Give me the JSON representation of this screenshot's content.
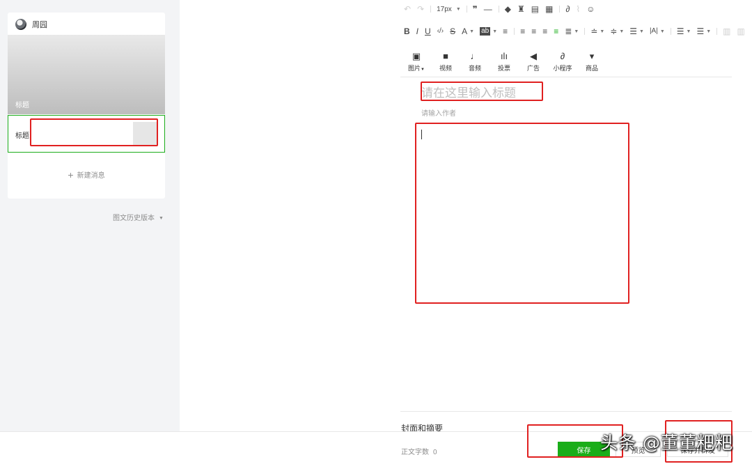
{
  "sidebar": {
    "account_name": "周园",
    "main_article_title": "标题",
    "sub_article_title": "标题",
    "new_message_label": "新建消息",
    "history_label": "图文历史版本"
  },
  "toolbar": {
    "font_size": "17px",
    "media": [
      {
        "label": "图片",
        "icon": "image-icon"
      },
      {
        "label": "视频",
        "icon": "video-icon"
      },
      {
        "label": "音频",
        "icon": "microphone-icon"
      },
      {
        "label": "投票",
        "icon": "poll-icon"
      },
      {
        "label": "广告",
        "icon": "megaphone-icon"
      },
      {
        "label": "小程序",
        "icon": "mini-program-icon"
      },
      {
        "label": "商品",
        "icon": "product-icon"
      }
    ]
  },
  "editor": {
    "title_placeholder": "请在这里输入标题",
    "author_placeholder": "请输入作者",
    "cover_label": "封面和摘要"
  },
  "footer": {
    "word_count_label": "正文字数",
    "word_count": "0",
    "save_label": "保存",
    "preview_label": "预览",
    "publish_label": "保存并群发"
  },
  "watermark": "头条 @董董粑粑",
  "colors": {
    "accent": "#1aad19",
    "annotation": "#e02020",
    "sidebar_bg": "#f3f4f6"
  }
}
